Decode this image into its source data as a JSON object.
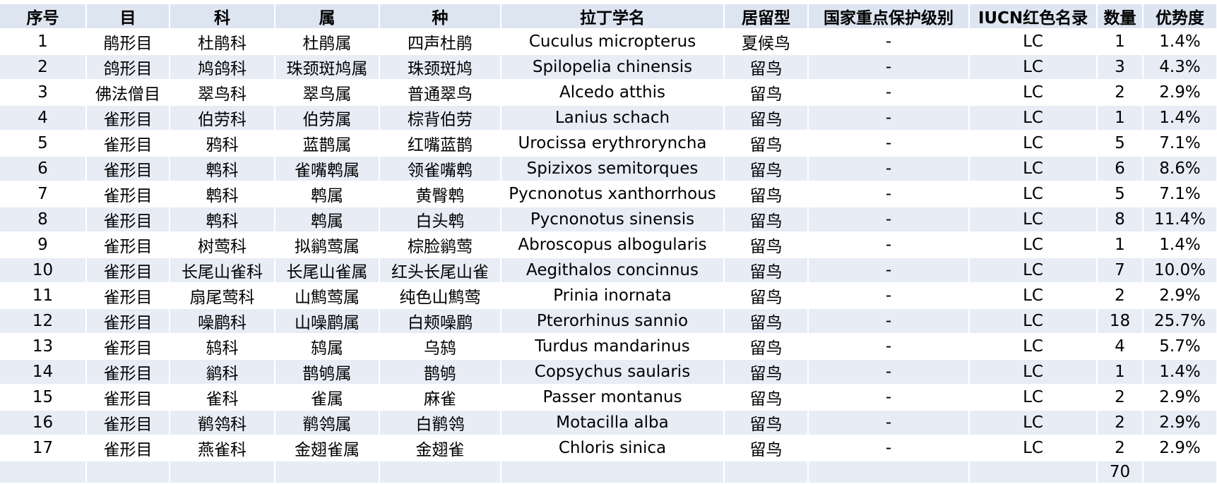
{
  "headers": [
    "序号",
    "目",
    "科",
    "属",
    "种",
    "拉丁学名",
    "居留型",
    "国家重点保护级别",
    "IUCN红色名录",
    "数量",
    "优势度"
  ],
  "rows": [
    [
      "1",
      "鹃形目",
      "杜鹃科",
      "杜鹃属",
      "四声杜鹃",
      "Cuculus micropterus",
      "夏候鸟",
      "-",
      "LC",
      "1",
      "1.4%"
    ],
    [
      "2",
      "鸽形目",
      "鸠鸽科",
      "珠颈斑鸠属",
      "珠颈斑鸠",
      "Spilopelia chinensis",
      "留鸟",
      "-",
      "LC",
      "3",
      "4.3%"
    ],
    [
      "3",
      "佛法僧目",
      "翠鸟科",
      "翠鸟属",
      "普通翠鸟",
      "Alcedo atthis",
      "留鸟",
      "-",
      "LC",
      "2",
      "2.9%"
    ],
    [
      "4",
      "雀形目",
      "伯劳科",
      "伯劳属",
      "棕背伯劳",
      "Lanius schach",
      "留鸟",
      "-",
      "LC",
      "1",
      "1.4%"
    ],
    [
      "5",
      "雀形目",
      "鸦科",
      "蓝鹊属",
      "红嘴蓝鹊",
      "Urocissa erythroryncha",
      "留鸟",
      "-",
      "LC",
      "5",
      "7.1%"
    ],
    [
      "6",
      "雀形目",
      "鹎科",
      "雀嘴鹎属",
      "领雀嘴鹎",
      "Spizixos semitorques",
      "留鸟",
      "-",
      "LC",
      "6",
      "8.6%"
    ],
    [
      "7",
      "雀形目",
      "鹎科",
      "鹎属",
      "黄臀鹎",
      "Pycnonotus xanthorrhous",
      "留鸟",
      "-",
      "LC",
      "5",
      "7.1%"
    ],
    [
      "8",
      "雀形目",
      "鹎科",
      "鹎属",
      "白头鹎",
      "Pycnonotus sinensis",
      "留鸟",
      "-",
      "LC",
      "8",
      "11.4%"
    ],
    [
      "9",
      "雀形目",
      "树莺科",
      "拟鹟莺属",
      "棕脸鹟莺",
      "Abroscopus albogularis",
      "留鸟",
      "-",
      "LC",
      "1",
      "1.4%"
    ],
    [
      "10",
      "雀形目",
      "长尾山雀科",
      "长尾山雀属",
      "红头长尾山雀",
      "Aegithalos concinnus",
      "留鸟",
      "-",
      "LC",
      "7",
      "10.0%"
    ],
    [
      "11",
      "雀形目",
      "扇尾莺科",
      "山鹪莺属",
      "纯色山鹪莺",
      "Prinia inornata",
      "留鸟",
      "-",
      "LC",
      "2",
      "2.9%"
    ],
    [
      "12",
      "雀形目",
      "噪鹛科",
      "山噪鹛属",
      "白颊噪鹛",
      "Pterorhinus sannio",
      "留鸟",
      "-",
      "LC",
      "18",
      "25.7%"
    ],
    [
      "13",
      "雀形目",
      "鸫科",
      "鸫属",
      "乌鸫",
      "Turdus mandarinus",
      "留鸟",
      "-",
      "LC",
      "4",
      "5.7%"
    ],
    [
      "14",
      "雀形目",
      "鹟科",
      "鹊鸲属",
      "鹊鸲",
      "Copsychus saularis",
      "留鸟",
      "-",
      "LC",
      "1",
      "1.4%"
    ],
    [
      "15",
      "雀形目",
      "雀科",
      "雀属",
      "麻雀",
      "Passer montanus",
      "留鸟",
      "-",
      "LC",
      "2",
      "2.9%"
    ],
    [
      "16",
      "雀形目",
      "鹡鸰科",
      "鹡鸰属",
      "白鹡鸰",
      "Motacilla alba",
      "留鸟",
      "-",
      "LC",
      "2",
      "2.9%"
    ],
    [
      "17",
      "雀形目",
      "燕雀科",
      "金翅雀属",
      "金翅雀",
      "Chloris sinica",
      "留鸟",
      "-",
      "LC",
      "2",
      "2.9%"
    ]
  ],
  "total": {
    "count": "70"
  },
  "colors": {
    "header_bg": "#dde5f1",
    "band_bg": "#e7ecf5",
    "row_bg": "#ffffff",
    "text": "#000000"
  }
}
